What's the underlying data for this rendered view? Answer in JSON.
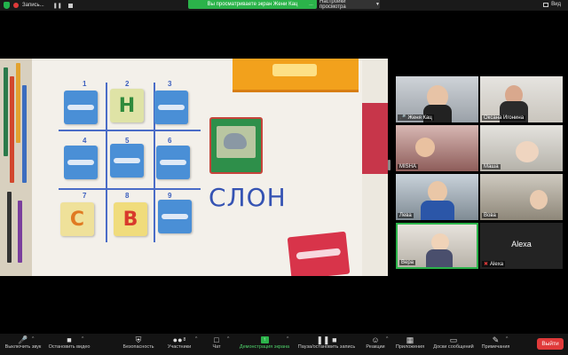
{
  "top_bar": {
    "recording_label": "Запись...",
    "share_banner": "Вы просматриваете экран Жени Кац",
    "view_settings": "Настройки просмотра",
    "view_label": "Вид"
  },
  "shared_screen": {
    "grid_numbers": [
      "1",
      "2",
      "3",
      "4",
      "5",
      "6",
      "7",
      "8",
      "9"
    ],
    "letter_cards": [
      "Н",
      "С",
      "В"
    ],
    "word": "СЛОН"
  },
  "participants": [
    {
      "name": "Женя Кац",
      "muted": false
    },
    {
      "name": "Оксана Игонина",
      "muted": false
    },
    {
      "name": "MISHA",
      "muted": false
    },
    {
      "name": "Маша",
      "muted": false
    },
    {
      "name": "Лева",
      "muted": false
    },
    {
      "name": "Вова",
      "muted": false
    },
    {
      "name": "Вера",
      "muted": false
    },
    {
      "name": "Alexa",
      "muted": true,
      "center_label": "Alexa"
    }
  ],
  "toolbar": {
    "mute": "Выключить звук",
    "video": "Остановить видео",
    "security": "Безопасность",
    "participants": "Участники",
    "participants_count": "8",
    "chat": "Чат",
    "share": "Демонстрация экрана",
    "pause_record": "Пауза/остановить запись",
    "reactions": "Реакции",
    "apps": "Приложения",
    "whiteboards": "Доски сообщений",
    "notes": "Примечания",
    "leave": "Выйти"
  },
  "colors": {
    "accent_green": "#2bb34a",
    "leave_red": "#e03a3a",
    "grid_blue": "#4a6cc7"
  }
}
